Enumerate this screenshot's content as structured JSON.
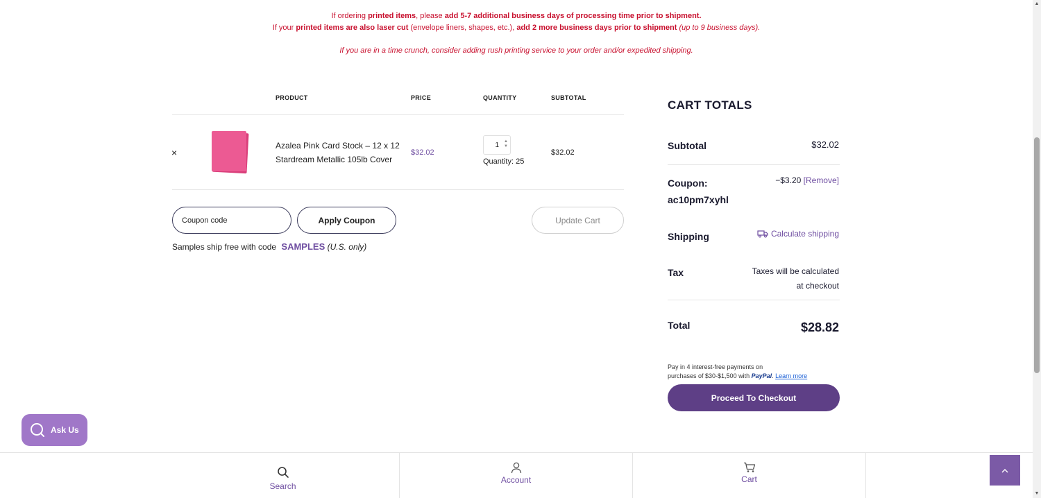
{
  "notices": {
    "line1": {
      "a": "If ordering ",
      "b": "printed items",
      "c": ", please ",
      "d": "add 5-7 additional business days of processing time prior to shipment."
    },
    "line2": {
      "a": "If your ",
      "b": "printed items are also laser cut",
      "c": " (envelope liners, shapes, etc.), ",
      "d": "add 2 more business days prior to shipment",
      "e": " (up to 9 business days)."
    },
    "line3": "If you are in a time crunch, consider adding rush printing service to your order and/or expedited shipping."
  },
  "cart_table": {
    "headers": {
      "product": "PRODUCT",
      "price": "PRICE",
      "quantity": "QUANTITY",
      "subtotal": "SUBTOTAL"
    },
    "items": [
      {
        "remove": "×",
        "product_name": "Azalea Pink Card Stock – 12 x 12 Stardream Metallic 105lb Cover",
        "price": "$32.02",
        "quantity": "1",
        "quantity_note": "Quantity: 25",
        "subtotal": "$32.02",
        "thumb_color": "#e8508a"
      }
    ]
  },
  "coupon": {
    "placeholder": "Coupon code",
    "apply_label": "Apply Coupon",
    "update_label": "Update Cart",
    "samples_text": "Samples ship free with code",
    "samples_code": "SAMPLES",
    "samples_note": "(U.S. only)"
  },
  "cart_totals": {
    "title": "CART TOTALS",
    "subtotal_label": "Subtotal",
    "subtotal_value": "$32.02",
    "coupon_label": "Coupon:",
    "coupon_code": "ac10pm7xyhl",
    "coupon_discount": "−$3.20",
    "coupon_remove": "[Remove]",
    "shipping_label": "Shipping",
    "shipping_action": "Calculate shipping",
    "tax_label": "Tax",
    "tax_note_1": "Taxes will be calculated",
    "tax_note_2": "at checkout",
    "total_label": "Total",
    "total_value": "$28.82"
  },
  "paylater": {
    "line1": "Pay in 4 interest-free payments on",
    "line2": "purchases of $30-$1,500 with",
    "brand": "PayPal",
    "sep": ".",
    "learn_more": "Learn more"
  },
  "checkout_label": "Proceed To Checkout",
  "ask_us": "Ask Us",
  "bottom_nav": {
    "search": "Search",
    "account": "Account",
    "cart": "Cart"
  },
  "colors": {
    "accent": "#6f4ea1",
    "notice_red": "#c8102e",
    "checkout": "#5e3f86"
  },
  "icons": {
    "search": "search-icon",
    "account": "user-icon",
    "cart": "cart-icon",
    "truck": "truck-icon",
    "chevron_up": "chevron-up-icon"
  }
}
